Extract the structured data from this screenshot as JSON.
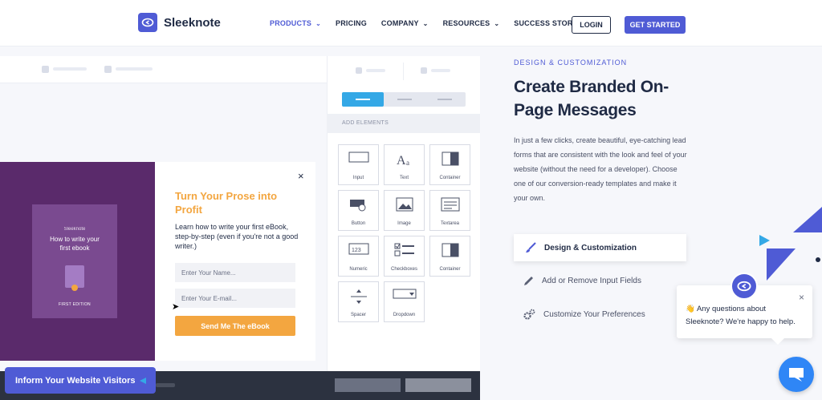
{
  "header": {
    "logo_text": "Sleeknote",
    "nav": [
      {
        "label": "PRODUCTS",
        "has_dropdown": true,
        "active": true
      },
      {
        "label": "PRICING",
        "has_dropdown": false,
        "active": false
      },
      {
        "label": "COMPANY",
        "has_dropdown": true,
        "active": false
      },
      {
        "label": "RESOURCES",
        "has_dropdown": true,
        "active": false
      },
      {
        "label": "SUCCESS STORIES",
        "has_dropdown": false,
        "active": false
      }
    ],
    "login_label": "LOGIN",
    "get_started_label": "GET STARTED"
  },
  "mock_popup": {
    "book": {
      "brand": "Sleeknote",
      "title": "How to write your first ebook",
      "edition": "FIRST EDITION"
    },
    "close_glyph": "×",
    "title": "Turn Your Prose into Profit",
    "body": "Learn how to write your first eBook, step-by-step (even if you're not a good writer.)",
    "name_placeholder": "Enter Your Name...",
    "email_placeholder": "Enter Your E-mail...",
    "submit_label": "Send Me The eBook"
  },
  "builder_panel": {
    "section_label": "ADD ELEMENTS",
    "elements": [
      {
        "label": "Input",
        "icon": "input-icon"
      },
      {
        "label": "Text",
        "icon": "text-icon"
      },
      {
        "label": "Container",
        "icon": "container-icon"
      },
      {
        "label": "Button",
        "icon": "button-icon"
      },
      {
        "label": "Image",
        "icon": "image-icon"
      },
      {
        "label": "Textarea",
        "icon": "textarea-icon"
      },
      {
        "label": "Numeric",
        "icon": "numeric-icon"
      },
      {
        "label": "Checkboxes",
        "icon": "checkboxes-icon"
      },
      {
        "label": "Container",
        "icon": "container-icon"
      },
      {
        "label": "Spacer",
        "icon": "spacer-icon"
      },
      {
        "label": "Dropdown",
        "icon": "dropdown-icon"
      }
    ]
  },
  "content": {
    "eyebrow": "DESIGN & CUSTOMIZATION",
    "heading": "Create Branded On-Page Messages",
    "description": "In just a few clicks, create beautiful, eye-catching lead forms that are consistent with the look and feel of your website (without the need for a developer). Choose one of our conversion-ready templates and make it your own.",
    "features": [
      {
        "label": "Design & Customization",
        "icon": "brush-icon",
        "active": true
      },
      {
        "label": "Add or Remove Input Fields",
        "icon": "pencil-icon",
        "active": false
      },
      {
        "label": "Customize Your Preferences",
        "icon": "gears-icon",
        "active": false
      }
    ]
  },
  "chat": {
    "emoji": "👋",
    "message": "Any questions about Sleeknote? We're happy to help.",
    "close_glyph": "×"
  },
  "inform_badge": {
    "label": "Inform Your Website Visitors"
  },
  "colors": {
    "brand": "#4f5bd5",
    "accent_orange": "#f3a640",
    "popup_purple": "#5a2a6b",
    "chat_blue": "#2f86f6"
  }
}
